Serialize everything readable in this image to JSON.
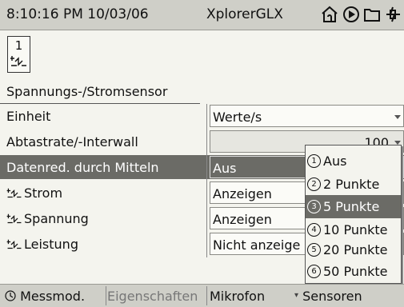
{
  "status_bar": {
    "time": "8:10:16 PM 10/03/06",
    "app_name": "XplorerGLX",
    "icons": [
      "home-icon",
      "play-icon",
      "folder-icon",
      "power-icon"
    ]
  },
  "sensor": {
    "number": "1",
    "title": "Spannungs-/Stromsensor"
  },
  "rows": [
    {
      "label": "Einheit",
      "value": "Werte/s"
    },
    {
      "label": "Abtastrate/-Interwall",
      "value": "100"
    },
    {
      "label": "Datenred. durch Mitteln",
      "value": "Aus"
    },
    {
      "label": "Strom",
      "value": "Anzeigen"
    },
    {
      "label": "Spannung",
      "value": "Anzeigen"
    },
    {
      "label": "Leistung",
      "value": "Nicht anzeige"
    }
  ],
  "dropdown": {
    "items": [
      {
        "num": "1",
        "label": "Aus"
      },
      {
        "num": "2",
        "label": "2 Punkte"
      },
      {
        "num": "3",
        "label": "5 Punkte"
      },
      {
        "num": "4",
        "label": "10 Punkte"
      },
      {
        "num": "5",
        "label": "20 Punkte"
      },
      {
        "num": "6",
        "label": "50 Punkte"
      }
    ],
    "selected_index": 2
  },
  "bottom_bar": {
    "tab1": "Messmod.",
    "tab2": "Eigenschaften",
    "tab3": "Mikrofon",
    "tab4": "Sensoren"
  }
}
